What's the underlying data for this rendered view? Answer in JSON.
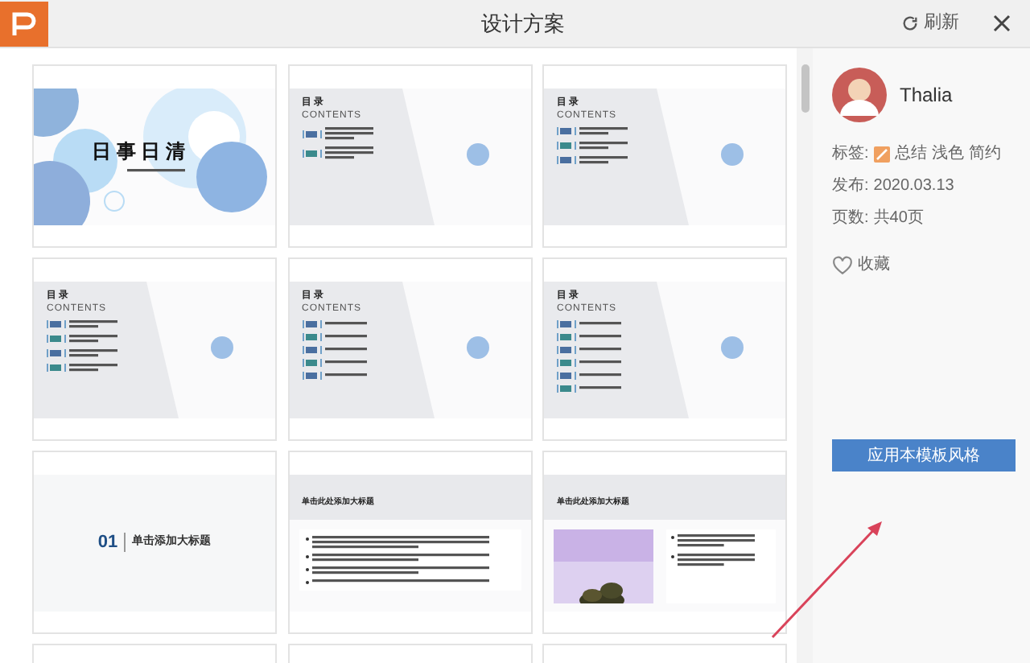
{
  "window": {
    "title": "设计方案",
    "refresh": "刷新"
  },
  "templates": [
    {
      "kind": "cover",
      "title": "日 事 日 清"
    },
    {
      "kind": "toc",
      "title": "目 录",
      "subtitle": "CONTENTS",
      "entries": [
        {
          "kind": "three-line"
        },
        {
          "kind": "three-line"
        }
      ]
    },
    {
      "kind": "toc",
      "title": "目 录",
      "subtitle": "CONTENTS",
      "entries": [
        {
          "kind": "two-line"
        },
        {
          "kind": "two-line"
        },
        {
          "kind": "two-line"
        }
      ]
    },
    {
      "kind": "toc",
      "title": "目 录",
      "subtitle": "CONTENTS",
      "entries": [
        {
          "kind": "two-line"
        },
        {
          "kind": "two-line"
        },
        {
          "kind": "two-line"
        },
        {
          "kind": "two-line"
        }
      ]
    },
    {
      "kind": "toc",
      "title": "目 录",
      "subtitle": "CONTENTS",
      "entries": [
        {
          "kind": "one-line"
        },
        {
          "kind": "one-line"
        },
        {
          "kind": "one-line"
        },
        {
          "kind": "one-line"
        },
        {
          "kind": "one-line"
        }
      ]
    },
    {
      "kind": "toc",
      "title": "目 录",
      "subtitle": "CONTENTS",
      "entries": [
        {
          "kind": "one-line"
        },
        {
          "kind": "one-line"
        },
        {
          "kind": "one-line"
        },
        {
          "kind": "one-line"
        },
        {
          "kind": "one-line"
        },
        {
          "kind": "one-line"
        }
      ]
    },
    {
      "kind": "section",
      "number": "01",
      "title": "单击添加大标题"
    },
    {
      "kind": "bullets",
      "title": "单击此处添加大标题",
      "entries": [
        {
          "kind": "three-line"
        },
        {
          "kind": "two-line"
        },
        {
          "kind": "two-line"
        },
        {
          "kind": "one-line"
        }
      ]
    },
    {
      "title": "单击此处添加大标题",
      "entries": [
        {
          "kind": "three-line"
        },
        {
          "kind": "three-line"
        }
      ]
    },
    {
      "kind": "blank"
    },
    {
      "kind": "blank"
    },
    {
      "kind": "blank"
    }
  ],
  "details": {
    "author": "Thalia",
    "tags_label": "标签:",
    "tags": [
      "总结",
      "浅色",
      "简约"
    ],
    "date_label": "发布:",
    "date": "2020.03.13",
    "pages_label": "页数:",
    "pages": "共40页",
    "favorite": "收藏",
    "apply_button": "应用本模板风格"
  }
}
